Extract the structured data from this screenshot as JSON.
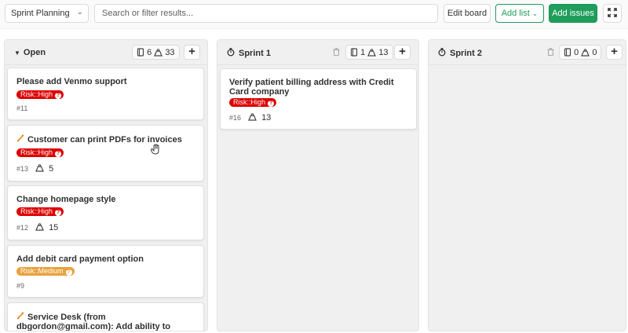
{
  "toolbar": {
    "board_select": "Sprint Planning",
    "search_placeholder": "Search or filter results...",
    "edit_board": "Edit board",
    "add_list": "Add list",
    "add_issues": "Add issues"
  },
  "lists": [
    {
      "title": "Open",
      "issue_count": "6",
      "weight_total": "33",
      "cards": [
        {
          "title": "Please add Venmo support",
          "label": "Risk::High",
          "ref": "#11",
          "weight": ""
        },
        {
          "title": "Customer can print PDFs for invoices",
          "label": "Risk::High",
          "ref": "#13",
          "weight": "5"
        },
        {
          "title": "Change homepage style",
          "label": "Risk::High",
          "ref": "#12",
          "weight": "15"
        },
        {
          "title": "Add debit card payment option",
          "label": "Risk::Medium",
          "ref": "#9",
          "weight": ""
        },
        {
          "title": "Service Desk (from dbgordon@gmail.com): Add ability to download billing statements as PDF",
          "label": "",
          "ref": "",
          "weight": ""
        }
      ]
    },
    {
      "title": "Sprint 1",
      "issue_count": "1",
      "weight_total": "13",
      "cards": [
        {
          "title": "Verify patient billing address with Credit Card company",
          "label": "Risk::High",
          "ref": "#16",
          "weight": "13"
        }
      ]
    },
    {
      "title": "Sprint 2",
      "issue_count": "0",
      "weight_total": "0",
      "cards": []
    }
  ],
  "colors": {
    "accent_green": "#1f9e5b",
    "risk_high": "#dd0000",
    "risk_medium": "#e8a23d"
  },
  "icons": {
    "caret": "caret-down-icon",
    "stopwatch": "stopwatch-icon",
    "issues": "issues-icon",
    "weight": "weight-icon",
    "trash": "trash-icon",
    "fullscreen": "fullscreen-icon",
    "confidential": "confidential-icon"
  }
}
